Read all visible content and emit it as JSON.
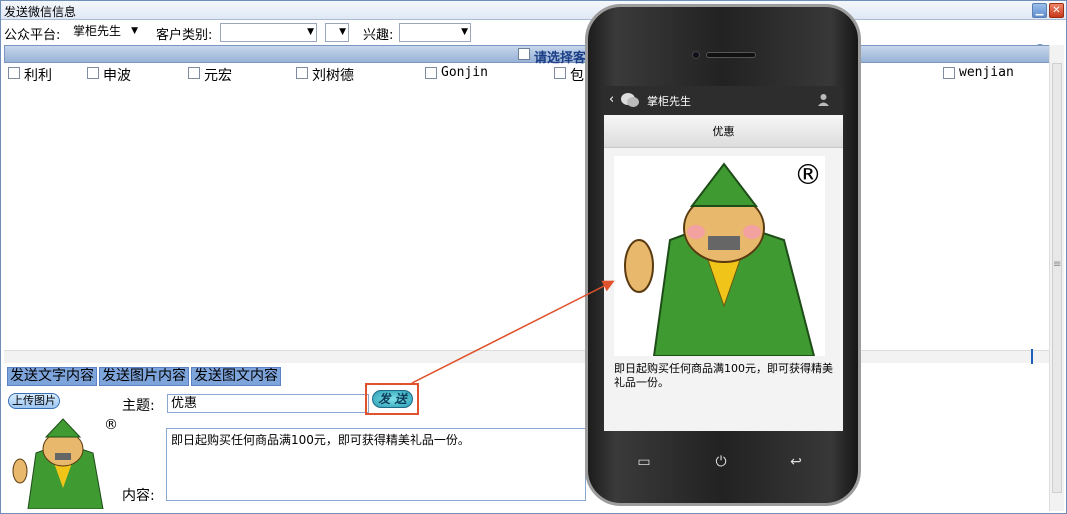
{
  "window": {
    "title": "发送微信信息"
  },
  "filters": {
    "platform_label": "公众平台:",
    "platform_value": "掌柜先生",
    "customer_type_label": "客户类别:",
    "customer_type_value": "",
    "interest_label": "兴趣:",
    "interest_value": ""
  },
  "header": {
    "select_label": "请选择客"
  },
  "users": [
    "利利",
    "申波",
    "元宏",
    "刘树德",
    "Gonjin",
    "包",
    "wenjian"
  ],
  "tabs": [
    "发送文字内容",
    "发送图片内容",
    "发送图文内容"
  ],
  "compose": {
    "upload_label": "上传图片",
    "subject_label": "主题:",
    "subject_value": "优惠",
    "send_label": "发 送",
    "content_label": "内容:",
    "content_value": "即日起购买任何商品满100元，即可获得精美礼品一份。"
  },
  "phone": {
    "account_name": "掌柜先生",
    "message_title": "优惠",
    "message_body": "即日起购买任何商品满100元，即可获得精美礼品一份。",
    "registered_mark": "®"
  },
  "colors": {
    "accent": "#7ea4dc",
    "highlight": "#e0522b"
  }
}
